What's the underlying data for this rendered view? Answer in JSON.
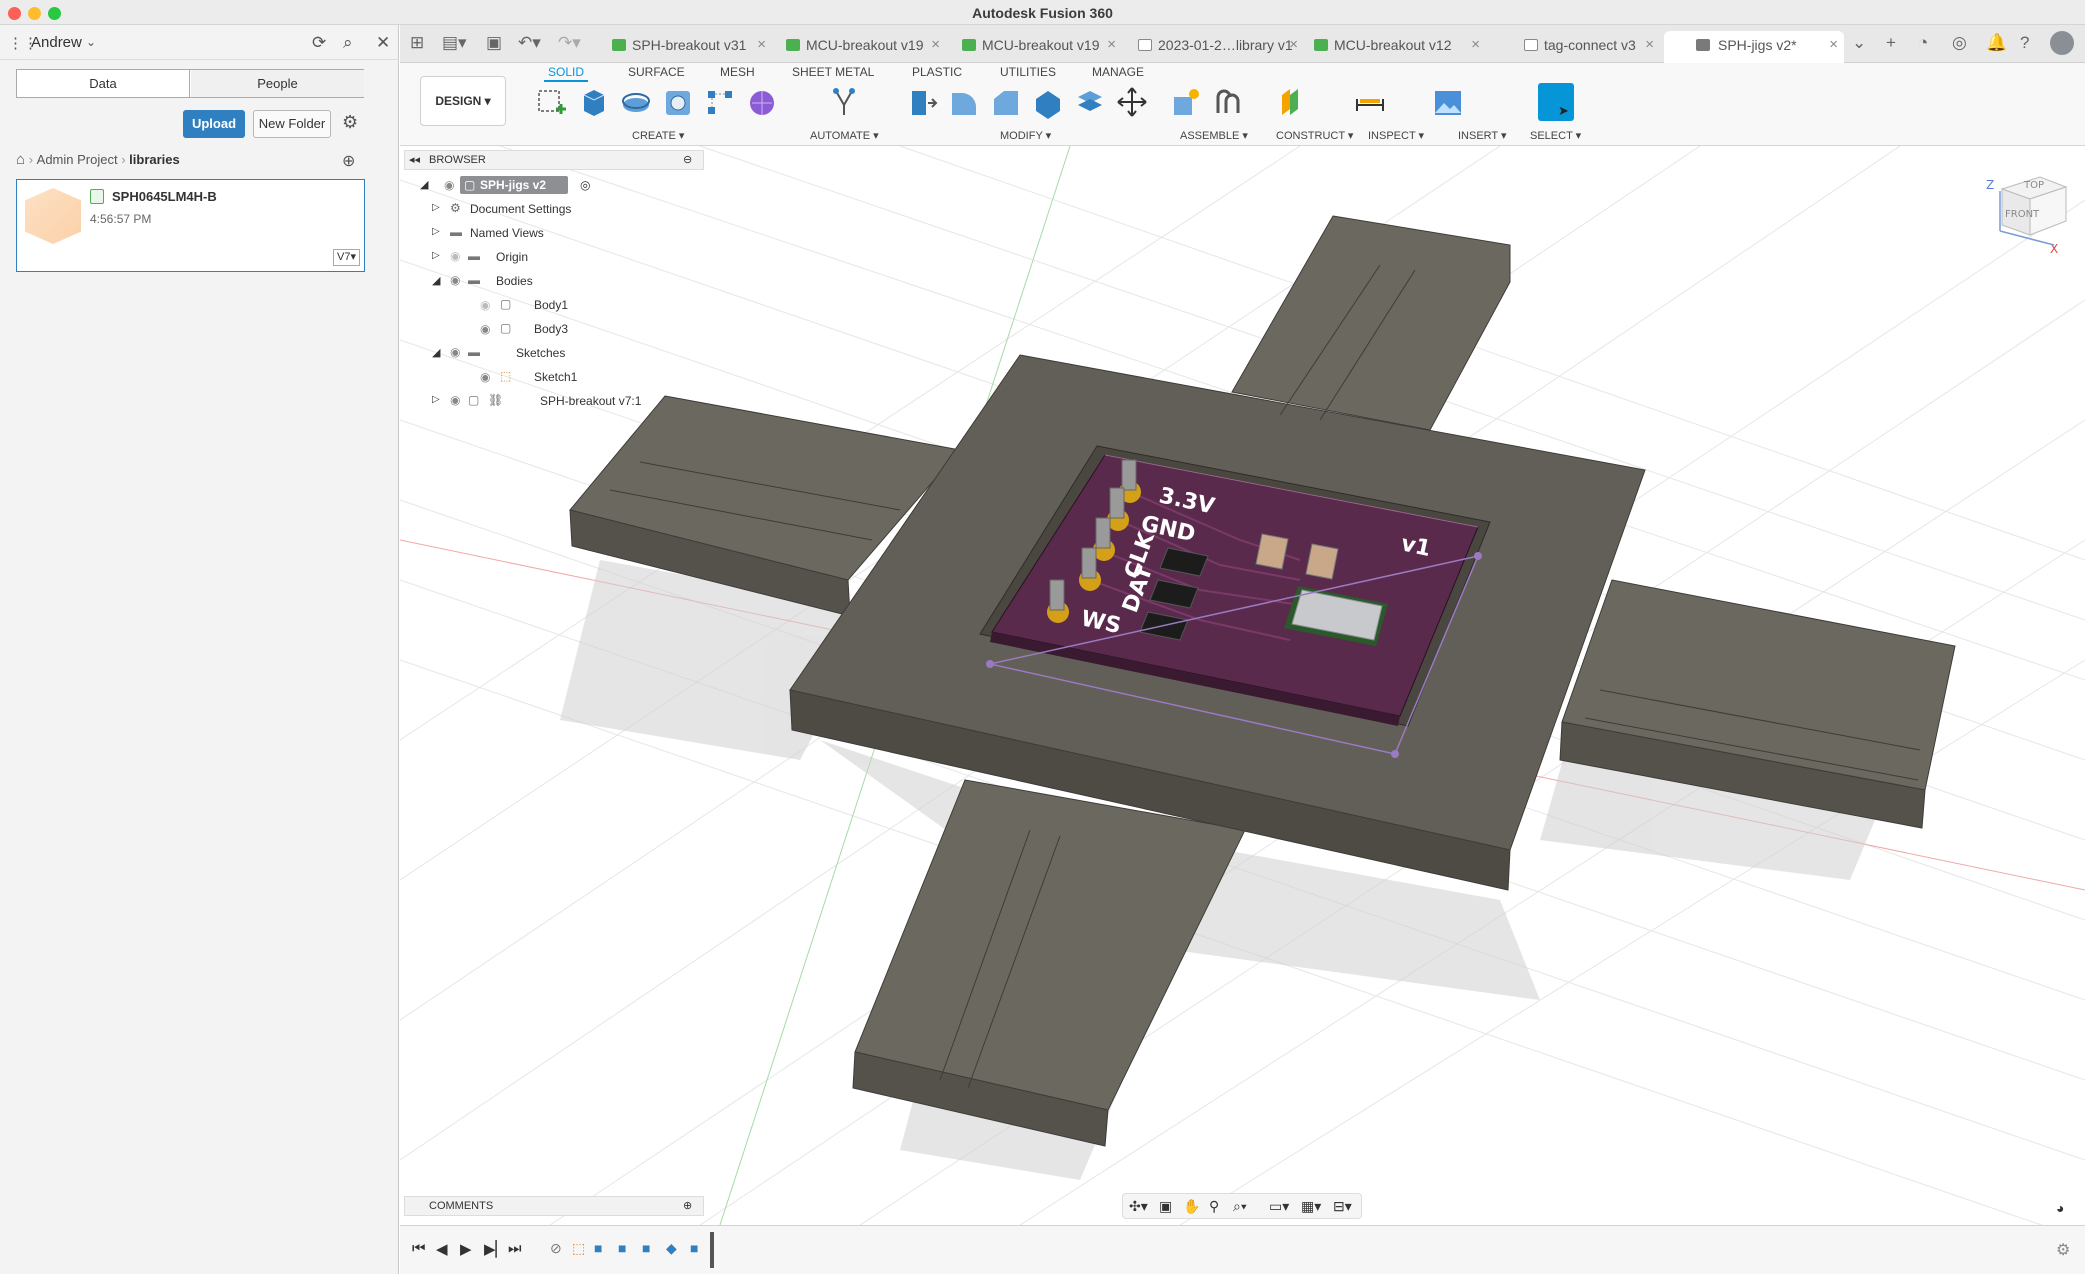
{
  "window": {
    "title": "Autodesk Fusion 360"
  },
  "data_panel": {
    "user": "Andrew",
    "tabs": [
      "Data",
      "People"
    ],
    "upload_label": "Upload",
    "new_folder_label": "New Folder",
    "breadcrumb": [
      "Admin Project",
      "libraries"
    ],
    "file": {
      "name": "SPH0645LM4H-B",
      "time": "4:56:57 PM",
      "version": "V7"
    }
  },
  "tabs": [
    {
      "label": "SPH-breakout v31",
      "icon_color": "#4caf50"
    },
    {
      "label": "MCU-breakout v19",
      "icon_color": "#4caf50"
    },
    {
      "label": "MCU-breakout v19",
      "icon_color": "#4caf50"
    },
    {
      "label": "2023-01-2…library v1",
      "icon_color": "#888888"
    },
    {
      "label": "MCU-breakout v12",
      "icon_color": "#4caf50"
    },
    {
      "label": "tag-connect v3",
      "icon_color": "#888888"
    },
    {
      "label": "SPH-jigs v2*",
      "icon_color": "#7a7a7a",
      "active": true
    }
  ],
  "toolbar": {
    "workspace": "DESIGN ▾",
    "mode_tabs": [
      "SOLID",
      "SURFACE",
      "MESH",
      "SHEET METAL",
      "PLASTIC",
      "UTILITIES",
      "MANAGE"
    ],
    "groups": {
      "create": "CREATE ▾",
      "automate": "AUTOMATE ▾",
      "modify": "MODIFY ▾",
      "assemble": "ASSEMBLE ▾",
      "construct": "CONSTRUCT ▾",
      "inspect": "INSPECT ▾",
      "insert": "INSERT ▾",
      "select": "SELECT ▾"
    },
    "accent": "#0696d7"
  },
  "browser": {
    "title": "BROWSER",
    "root": "SPH-jigs v2",
    "items": [
      "Document Settings",
      "Named Views",
      "Origin",
      "Bodies",
      "Body1",
      "Body3",
      "Sketches",
      "Sketch1",
      "SPH-breakout v7:1"
    ]
  },
  "pcb": {
    "labels": [
      "3.3V",
      "GND",
      "CLK",
      "DAT",
      "WS"
    ],
    "rev": "v1"
  },
  "viewcube": {
    "top": "TOP",
    "front": "FRONT",
    "z": "Z",
    "x": "X"
  },
  "comments": {
    "title": "COMMENTS"
  }
}
